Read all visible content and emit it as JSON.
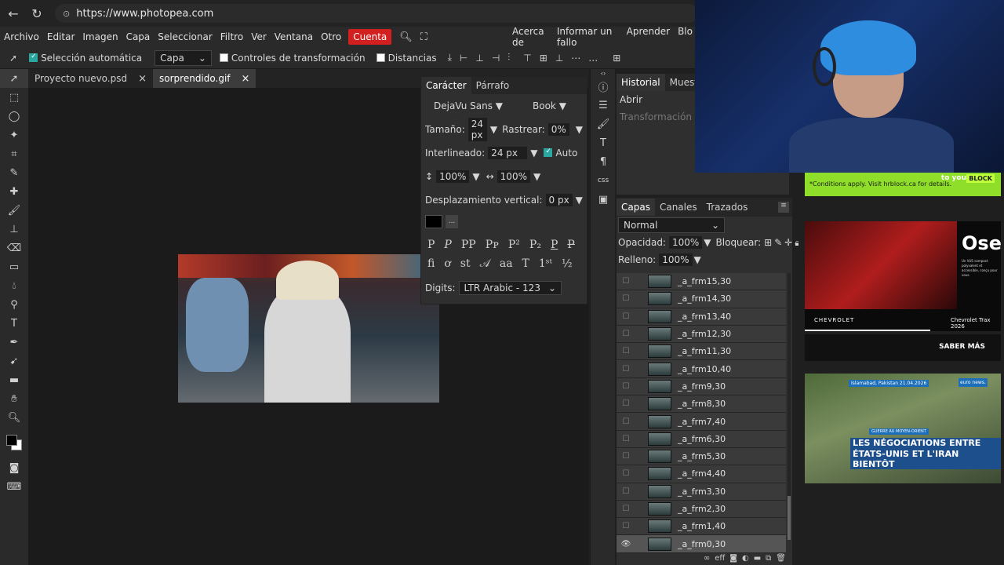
{
  "browser": {
    "url": "https://www.photopea.com",
    "url_host": "www.photopea.com"
  },
  "menu": {
    "items": [
      "Archivo",
      "Editar",
      "Imagen",
      "Capa",
      "Seleccionar",
      "Filtro",
      "Ver",
      "Ventana",
      "Otro"
    ],
    "account": "Cuenta",
    "right_items": [
      "Acerca de",
      "Informar un fallo",
      "Aprender",
      "Blo"
    ]
  },
  "options": {
    "auto_select_label": "Selección automática",
    "layer_select": "Capa",
    "transform_controls_label": "Controles de transformación",
    "distances_label": "Distancias"
  },
  "documents": {
    "tabs": [
      "Proyecto nuevo.psd",
      "sorprendido.gif"
    ],
    "close_glyph": "×"
  },
  "character_panel": {
    "tabs": [
      "Carácter",
      "Párrafo"
    ],
    "font_family": "DejaVu Sans",
    "font_style": "Book",
    "size_label": "Tamaño:",
    "size_value": "24 px",
    "tracking_label": "Rastrear:",
    "tracking_value": "0%",
    "leading_label": "Interlineado:",
    "leading_value": "24 px",
    "auto_label": "Auto",
    "vscale_value": "100%",
    "hscale_value": "100%",
    "baseline_label": "Desplazamiento vertical:",
    "baseline_value": "0 px",
    "more_button": "...",
    "digits_label": "Digits:",
    "digits_value": "LTR Arabic - 123"
  },
  "history_panel": {
    "tabs": [
      "Historial",
      "Muestra"
    ],
    "items": [
      "Abrir",
      "Transformación libr"
    ]
  },
  "layers_panel": {
    "tabs": [
      "Capas",
      "Canales",
      "Trazados"
    ],
    "blend_mode": "Normal",
    "opacity_label": "Opacidad:",
    "opacity_value": "100%",
    "lock_label": "Bloquear:",
    "fill_label": "Relleno:",
    "fill_value": "100%",
    "layers": [
      "_a_frm15,30",
      "_a_frm14,30",
      "_a_frm13,40",
      "_a_frm12,30",
      "_a_frm11,30",
      "_a_frm10,40",
      "_a_frm9,30",
      "_a_frm8,30",
      "_a_frm7,40",
      "_a_frm6,30",
      "_a_frm5,30",
      "_a_frm4,40",
      "_a_frm3,30",
      "_a_frm2,30",
      "_a_frm1,40",
      "_a_frm0,30"
    ],
    "footer_icons": [
      "link-icon",
      "fx-icon",
      "mask-icon",
      "adjustment-icon",
      "folder-icon",
      "new-layer-icon",
      "trash-icon"
    ]
  },
  "ads": {
    "ad1_text": "*Conditions apply. Visit hrblock.ca for details.",
    "ad1_to": "to you",
    "ad1_block": "BLOCK",
    "ad2_title": "Ose",
    "ad2_small": "Un VUS compact polyvalent et accessible, conçu pour vous.",
    "ad2_brand": "CHEVROLET",
    "ad2_model": "Chevrolet Trax 2026",
    "ad2_cta": "SABER MÁS",
    "ad3_loc": "Islamabad, Pakistan 21.04.2026",
    "ad3_logo": "euro news.",
    "ad3_tag": "GUERRE AU MOYEN-ORIENT",
    "ad3_line1": "LES NÉGOCIATIONS ENTRE LES",
    "ad3_line2": "ÉTATS-UNIS ET L'IRAN BIENTÔT"
  }
}
